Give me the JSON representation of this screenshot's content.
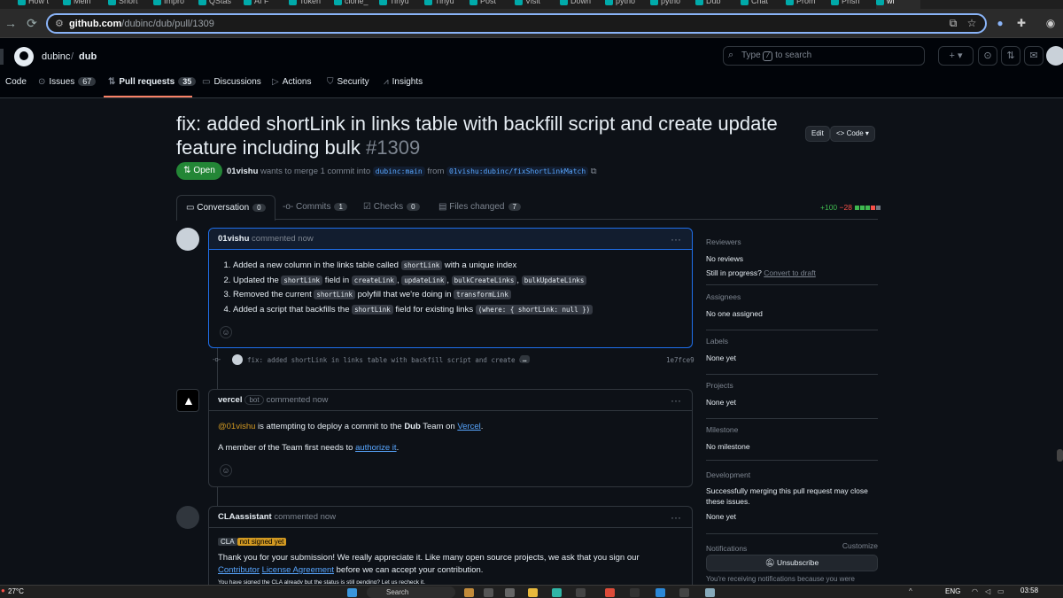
{
  "browser": {
    "tabs": [
      "How t",
      "Melh",
      "Short",
      "Impro",
      "QStas",
      "AI F",
      "Token",
      "clone_",
      "Tinyu",
      "Tinyu",
      "Post",
      "Visit",
      "Down",
      "pytho",
      "pytho",
      "Dub",
      "Chat",
      "Prom",
      "Prisn",
      "wi"
    ],
    "url_host": "github.com",
    "url_path": "/dubinc/dub/pull/1309"
  },
  "header": {
    "owner": "dubinc",
    "separator": "/",
    "repo": "dub",
    "search_placeholder_pre": "Type",
    "search_key": "/",
    "search_placeholder_post": "to search"
  },
  "repo_nav": [
    {
      "label": "Code",
      "icon": "code-icon"
    },
    {
      "label": "Issues",
      "icon": "issue-icon",
      "count": "67"
    },
    {
      "label": "Pull requests",
      "icon": "pull-request-icon",
      "count": "35"
    },
    {
      "label": "Discussions",
      "icon": "discussion-icon"
    },
    {
      "label": "Actions",
      "icon": "play-icon"
    },
    {
      "label": "Security",
      "icon": "shield-icon"
    },
    {
      "label": "Insights",
      "icon": "graph-icon"
    }
  ],
  "pr": {
    "title": "fix: added shortLink in links table with backfill script and create update feature including bulk",
    "number": "#1309",
    "edit_label": "Edit",
    "code_label": "Code",
    "state": "Open",
    "author": "01vishu",
    "merge_text": "wants to merge 1 commit into",
    "base_branch": "dubinc:main",
    "from_text": "from",
    "head_branch": "01vishu:dubinc/fixShortLinkMatch"
  },
  "tabs": [
    {
      "label": "Conversation",
      "count": "0"
    },
    {
      "label": "Commits",
      "count": "1"
    },
    {
      "label": "Checks",
      "count": "0"
    },
    {
      "label": "Files changed",
      "count": "7"
    }
  ],
  "diffstat": {
    "additions": "+100",
    "deletions": "−28"
  },
  "comments": [
    {
      "author": "01vishu",
      "meta": "commented now",
      "items": [
        [
          "Added a new column in the links table called",
          "shortLink",
          "with a unique index"
        ],
        [
          "Updated the",
          "shortLink",
          "field in",
          "createLink",
          ",",
          "updateLink",
          ",",
          "bulkCreateLinks",
          ",",
          "bulkUpdateLinks"
        ],
        [
          "Removed the current",
          "shortLink",
          "polyfill that we're doing in",
          "transformLink"
        ],
        [
          "Added a script that backfills the",
          "shortLink",
          "field for existing links",
          "(where: { shortLink: null })"
        ]
      ]
    },
    {
      "author": "vercel",
      "badge": "bot",
      "meta": "commented now",
      "mention": "@01vishu",
      "line1_a": "is attempting to deploy a commit to the",
      "line1_team": "Dub",
      "line1_b": "Team on",
      "line1_link": "Vercel",
      "line1_end": ".",
      "line2_a": "A member of the Team first needs to",
      "line2_link": "authorize it",
      "line2_end": "."
    },
    {
      "author": "CLAassistant",
      "meta": "commented now",
      "cla_label": "CLA",
      "cla_status": "not signed yet",
      "text_a": "Thank you for your submission! We really appreciate it. Like many open source projects, we ask that you sign our",
      "link_a": "Contributor",
      "link_b": "License Agreement",
      "text_b": "before we can accept your contribution.",
      "cut_line": "You have signed the CLA already but the status is still pending? Let us recheck it."
    }
  ],
  "commit": {
    "message": "fix: added shortLink in links table with backfill script and create u…",
    "more": "…",
    "sha": "1e7fce9"
  },
  "sidebar": {
    "reviewers_title": "Reviewers",
    "reviewers_value": "No reviews",
    "progress_text": "Still in progress?",
    "progress_link": "Convert to draft",
    "assignees_title": "Assignees",
    "assignees_value": "No one assigned",
    "labels_title": "Labels",
    "labels_value": "None yet",
    "projects_title": "Projects",
    "projects_value": "None yet",
    "milestone_title": "Milestone",
    "milestone_value": "No milestone",
    "development_title": "Development",
    "development_text": "Successfully merging this pull request may close these issues.",
    "development_value": "None yet",
    "notifications_title": "Notifications",
    "customize": "Customize",
    "unsubscribe": "Unsubscribe",
    "notify_reason": "You're receiving notifications because you were"
  },
  "taskbar": {
    "temperature": "27°C",
    "search": "Search",
    "lang": "ENG",
    "time": "03:58"
  }
}
